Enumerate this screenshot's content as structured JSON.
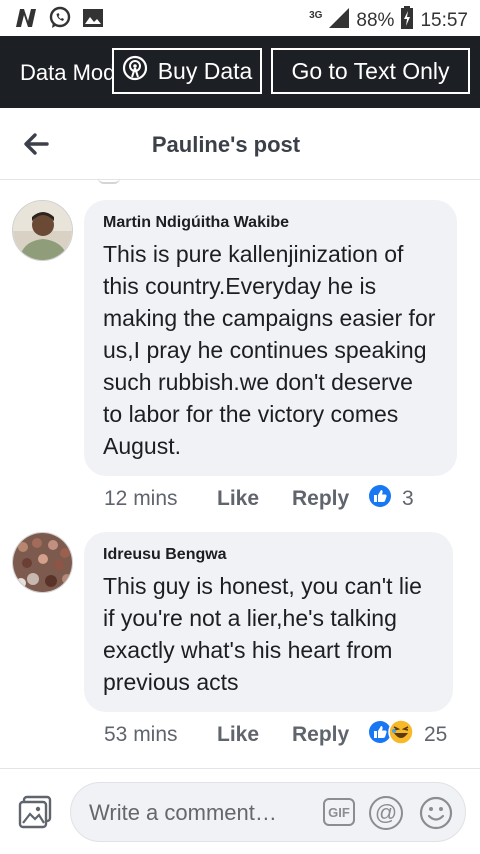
{
  "status_bar": {
    "network_type": "3G",
    "battery": "88%",
    "time": "15:57",
    "icons": [
      "n-app-icon",
      "whatsapp-icon",
      "gallery-icon",
      "signal-icon",
      "battery-icon"
    ]
  },
  "data_bar": {
    "mode_label": "Data Mode",
    "buy_data_label": "Buy Data",
    "text_only_label": "Go to Text Only"
  },
  "header": {
    "title": "Pauline's post"
  },
  "comments": [
    {
      "author": "Martin Ndigúitha Wakibe",
      "text": "This is pure kallenjinization of this country.Everyday he is making the campaigns easier for us,I pray he continues speaking such rubbish.we don't deserve to labor for the victory comes August.",
      "time": "12 mins",
      "like_label": "Like",
      "reply_label": "Reply",
      "reaction_count": "3",
      "reactions": [
        "like-reaction-icon"
      ]
    },
    {
      "author": "Idreusu Bengwa",
      "text": "This guy is honest, you can't lie if you're not a lier,he's talking exactly what's his heart from previous acts",
      "time": "53 mins",
      "like_label": "Like",
      "reply_label": "Reply",
      "reaction_count": "25",
      "reactions": [
        "like-reaction-icon",
        "haha-reaction-icon"
      ]
    }
  ],
  "composer": {
    "placeholder": "Write a comment…",
    "gif_label": "GIF",
    "at_label": "@"
  },
  "colors": {
    "data_bar_bg": "#1c2024",
    "bubble_bg": "#f0f2f5",
    "like_blue": "#1877f2",
    "haha_yellow": "#f7b928"
  }
}
